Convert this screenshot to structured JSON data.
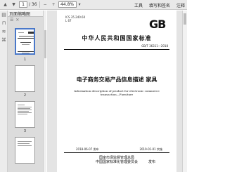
{
  "toolbar": {
    "page_current": "1",
    "page_total": "/ 36",
    "zoom": "44.8%",
    "links": [
      "工具",
      "填写和签名",
      "注释"
    ]
  },
  "thumbnails": {
    "title": "页面缩略图",
    "pages": [
      {
        "label": "1",
        "selected": true
      },
      {
        "label": "2",
        "selected": false
      },
      {
        "label": "3",
        "selected": false
      }
    ]
  },
  "document": {
    "ics": "ICS 35.240.60\nL 67",
    "logo": "GB",
    "standard_title": "中华人民共和国国家标准",
    "standard_number": "GB/T 36311—2018",
    "title_zh": "电子商务交易产品信息描述   家具",
    "title_en": "Information description of product for electronic commerce transaction—Furniture",
    "date_issue": "2018-06-07 发布",
    "date_effective": "2019-01-01 实施",
    "issuer_line1": "国家市场监督管理总局",
    "issuer_line2": "中国国家标准化管理委员会",
    "issuer_suffix": "发布"
  }
}
